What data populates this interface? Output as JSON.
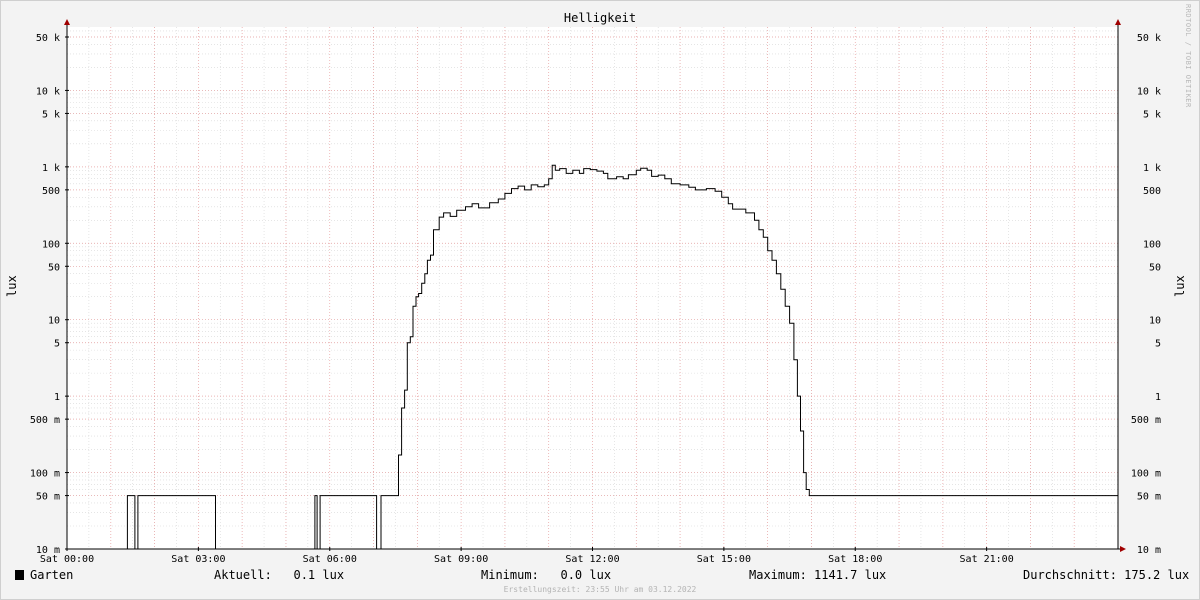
{
  "chart_data": {
    "type": "line",
    "title": "Helligkeit",
    "ylabel": "lux",
    "y_scale": "log",
    "ylim": [
      0.01,
      50000
    ],
    "xlim": [
      0,
      24
    ],
    "x_unit": "hours (Sat)",
    "x_ticks": [
      {
        "value": 0,
        "label": "Sat 00:00"
      },
      {
        "value": 3,
        "label": "Sat 03:00"
      },
      {
        "value": 6,
        "label": "Sat 06:00"
      },
      {
        "value": 9,
        "label": "Sat 09:00"
      },
      {
        "value": 12,
        "label": "Sat 12:00"
      },
      {
        "value": 15,
        "label": "Sat 15:00"
      },
      {
        "value": 18,
        "label": "Sat 18:00"
      },
      {
        "value": 21,
        "label": "Sat 21:00"
      }
    ],
    "y_ticks": [
      {
        "value": 50000,
        "label": "50 k"
      },
      {
        "value": 10000,
        "label": "10 k"
      },
      {
        "value": 5000,
        "label": "5 k"
      },
      {
        "value": 1000,
        "label": "1 k"
      },
      {
        "value": 500,
        "label": "500"
      },
      {
        "value": 100,
        "label": "100"
      },
      {
        "value": 50,
        "label": "50"
      },
      {
        "value": 10,
        "label": "10"
      },
      {
        "value": 5,
        "label": "5"
      },
      {
        "value": 1,
        "label": "1"
      },
      {
        "value": 0.5,
        "label": "500 m"
      },
      {
        "value": 0.1,
        "label": "100 m"
      },
      {
        "value": 0.05,
        "label": "50 m"
      },
      {
        "value": 0.01,
        "label": "10 m"
      }
    ],
    "grid": true,
    "series": [
      {
        "name": "Garten",
        "color": "#000000",
        "points": [
          [
            0.0,
            0.01
          ],
          [
            1.38,
            0.01
          ],
          [
            1.38,
            0.05
          ],
          [
            1.55,
            0.05
          ],
          [
            1.55,
            0.01
          ],
          [
            1.62,
            0.01
          ],
          [
            1.62,
            0.05
          ],
          [
            3.39,
            0.05
          ],
          [
            3.39,
            0.01
          ],
          [
            5.66,
            0.01
          ],
          [
            5.66,
            0.05
          ],
          [
            5.71,
            0.05
          ],
          [
            5.71,
            0.01
          ],
          [
            5.78,
            0.01
          ],
          [
            5.78,
            0.05
          ],
          [
            7.07,
            0.05
          ],
          [
            7.07,
            0.01
          ],
          [
            7.17,
            0.01
          ],
          [
            7.17,
            0.05
          ],
          [
            7.57,
            0.05
          ],
          [
            7.57,
            0.17
          ],
          [
            7.64,
            0.17
          ],
          [
            7.64,
            0.7
          ],
          [
            7.71,
            0.7
          ],
          [
            7.71,
            1.2
          ],
          [
            7.77,
            1.2
          ],
          [
            7.77,
            5
          ],
          [
            7.84,
            5
          ],
          [
            7.84,
            6
          ],
          [
            7.9,
            6
          ],
          [
            7.9,
            15
          ],
          [
            7.97,
            15
          ],
          [
            7.97,
            20
          ],
          [
            8.03,
            20
          ],
          [
            8.03,
            22
          ],
          [
            8.1,
            22
          ],
          [
            8.1,
            30
          ],
          [
            8.17,
            30
          ],
          [
            8.17,
            40
          ],
          [
            8.23,
            40
          ],
          [
            8.23,
            60
          ],
          [
            8.3,
            60
          ],
          [
            8.3,
            70
          ],
          [
            8.37,
            70
          ],
          [
            8.37,
            150
          ],
          [
            8.5,
            150
          ],
          [
            8.5,
            220
          ],
          [
            8.6,
            220
          ],
          [
            8.6,
            250
          ],
          [
            8.75,
            250
          ],
          [
            8.75,
            225
          ],
          [
            8.9,
            225
          ],
          [
            8.9,
            270
          ],
          [
            9.1,
            270
          ],
          [
            9.1,
            300
          ],
          [
            9.25,
            300
          ],
          [
            9.25,
            330
          ],
          [
            9.4,
            330
          ],
          [
            9.4,
            290
          ],
          [
            9.65,
            290
          ],
          [
            9.65,
            340
          ],
          [
            9.85,
            340
          ],
          [
            9.85,
            380
          ],
          [
            10.0,
            380
          ],
          [
            10.0,
            450
          ],
          [
            10.15,
            450
          ],
          [
            10.15,
            520
          ],
          [
            10.3,
            520
          ],
          [
            10.3,
            560
          ],
          [
            10.45,
            560
          ],
          [
            10.45,
            500
          ],
          [
            10.6,
            500
          ],
          [
            10.6,
            580
          ],
          [
            10.75,
            580
          ],
          [
            10.75,
            550
          ],
          [
            10.9,
            550
          ],
          [
            10.9,
            580
          ],
          [
            11.0,
            580
          ],
          [
            11.0,
            700
          ],
          [
            11.08,
            700
          ],
          [
            11.08,
            1050
          ],
          [
            11.15,
            1050
          ],
          [
            11.15,
            900
          ],
          [
            11.25,
            900
          ],
          [
            11.25,
            950
          ],
          [
            11.4,
            950
          ],
          [
            11.4,
            820
          ],
          [
            11.55,
            820
          ],
          [
            11.55,
            900
          ],
          [
            11.7,
            900
          ],
          [
            11.7,
            820
          ],
          [
            11.8,
            820
          ],
          [
            11.8,
            950
          ],
          [
            11.95,
            950
          ],
          [
            11.95,
            920
          ],
          [
            12.1,
            920
          ],
          [
            12.1,
            880
          ],
          [
            12.25,
            880
          ],
          [
            12.25,
            820
          ],
          [
            12.35,
            820
          ],
          [
            12.35,
            700
          ],
          [
            12.55,
            700
          ],
          [
            12.55,
            740
          ],
          [
            12.7,
            740
          ],
          [
            12.7,
            700
          ],
          [
            12.82,
            700
          ],
          [
            12.82,
            790
          ],
          [
            13.0,
            790
          ],
          [
            13.0,
            900
          ],
          [
            13.1,
            900
          ],
          [
            13.1,
            960
          ],
          [
            13.25,
            960
          ],
          [
            13.25,
            900
          ],
          [
            13.35,
            900
          ],
          [
            13.35,
            750
          ],
          [
            13.5,
            750
          ],
          [
            13.5,
            780
          ],
          [
            13.65,
            780
          ],
          [
            13.65,
            700
          ],
          [
            13.8,
            700
          ],
          [
            13.8,
            600
          ],
          [
            14.0,
            600
          ],
          [
            14.0,
            580
          ],
          [
            14.2,
            580
          ],
          [
            14.2,
            540
          ],
          [
            14.35,
            540
          ],
          [
            14.35,
            500
          ],
          [
            14.6,
            500
          ],
          [
            14.6,
            520
          ],
          [
            14.8,
            520
          ],
          [
            14.8,
            480
          ],
          [
            14.95,
            480
          ],
          [
            14.95,
            400
          ],
          [
            15.1,
            400
          ],
          [
            15.1,
            330
          ],
          [
            15.2,
            330
          ],
          [
            15.2,
            280
          ],
          [
            15.5,
            280
          ],
          [
            15.5,
            250
          ],
          [
            15.7,
            250
          ],
          [
            15.7,
            200
          ],
          [
            15.8,
            200
          ],
          [
            15.8,
            150
          ],
          [
            15.9,
            150
          ],
          [
            15.9,
            120
          ],
          [
            16.0,
            120
          ],
          [
            16.0,
            80
          ],
          [
            16.1,
            80
          ],
          [
            16.1,
            60
          ],
          [
            16.2,
            60
          ],
          [
            16.2,
            40
          ],
          [
            16.3,
            40
          ],
          [
            16.3,
            25
          ],
          [
            16.4,
            25
          ],
          [
            16.4,
            15
          ],
          [
            16.5,
            15
          ],
          [
            16.5,
            9
          ],
          [
            16.6,
            9
          ],
          [
            16.6,
            3
          ],
          [
            16.68,
            3
          ],
          [
            16.68,
            1
          ],
          [
            16.75,
            1
          ],
          [
            16.75,
            0.35
          ],
          [
            16.82,
            0.35
          ],
          [
            16.82,
            0.1
          ],
          [
            16.88,
            0.1
          ],
          [
            16.88,
            0.06
          ],
          [
            16.95,
            0.06
          ],
          [
            16.95,
            0.05
          ],
          [
            24.0,
            0.05
          ]
        ]
      }
    ]
  },
  "legend": {
    "series_name": "Garten",
    "aktuell": "Aktuell:   0.1 lux",
    "minimum": "Minimum:   0.0 lux",
    "maximum": "Maximum: 1141.7 lux",
    "durchschnitt": "Durchschnitt: 175.2 lux"
  },
  "watermark": "RRDTOOL / TOBI OETIKER",
  "footer": "Erstellungszeit: 23:55 Uhr am 03.12.2022",
  "colors": {
    "major_grid": "#e8a0a0",
    "minor_grid": "#d6d6d6",
    "axis": "#000000",
    "arrow": "#a00000",
    "plot_bg": "#ffffff",
    "canvas_bg": "#f3f3f3"
  }
}
